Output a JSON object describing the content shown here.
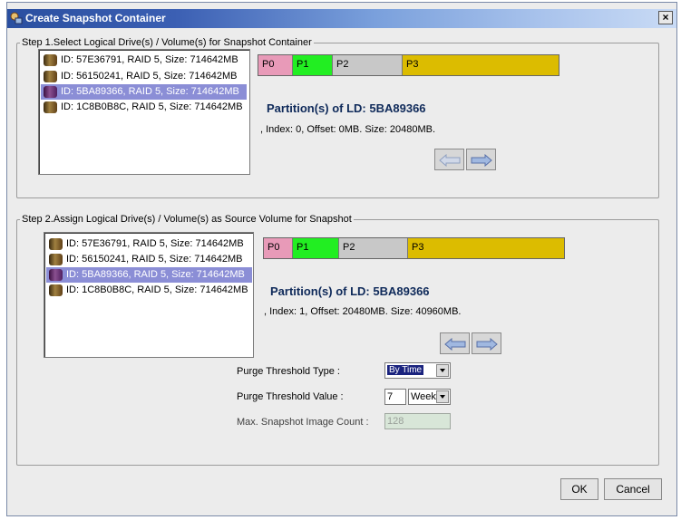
{
  "dialog": {
    "title": "Create Snapshot Container",
    "close_label": "×"
  },
  "step1": {
    "legend": "Step 1.Select Logical Drive(s) / Volume(s) for Snapshot Container",
    "drives": [
      "ID: 57E36791, RAID 5, Size: 714642MB",
      "ID: 56150241, RAID 5, Size: 714642MB",
      "ID: 5BA89366, RAID 5, Size: 714642MB",
      "ID: 1C8B0B8C, RAID 5, Size: 714642MB"
    ],
    "partitions": [
      "P0",
      "P1",
      "P2",
      "P3"
    ],
    "partition_title": "Partition(s) of LD: 5BA89366",
    "partition_info": ", Index: 0, Offset: 0MB. Size: 20480MB."
  },
  "step2": {
    "legend": "Step 2.Assign Logical Drive(s) / Volume(s) as Source Volume for Snapshot",
    "drives": [
      "ID: 57E36791, RAID 5, Size: 714642MB",
      "ID: 56150241, RAID 5, Size: 714642MB",
      "ID: 5BA89366, RAID 5, Size: 714642MB",
      "ID: 1C8B0B8C, RAID 5, Size: 714642MB"
    ],
    "partitions": [
      "P0",
      "P1",
      "P2",
      "P3"
    ],
    "partition_title": "Partition(s) of LD: 5BA89366",
    "partition_info": ", Index: 1, Offset: 20480MB. Size: 40960MB."
  },
  "settings": {
    "purge_type_label": "Purge Threshold Type :",
    "purge_type_value": "By Time",
    "purge_value_label": "Purge Threshold Value :",
    "purge_value": "7",
    "purge_unit": "Week",
    "max_count_label": "Max. Snapshot Image Count :",
    "max_count_value": "128"
  },
  "buttons": {
    "ok": "OK",
    "cancel": "Cancel"
  },
  "colors": {
    "p0": "#e89ab8",
    "p1": "#22ee22",
    "p2": "#c8c8c8",
    "p3": "#dcbc00",
    "selected": "#8b8ed6",
    "title_bar": "#2a4fa0"
  }
}
